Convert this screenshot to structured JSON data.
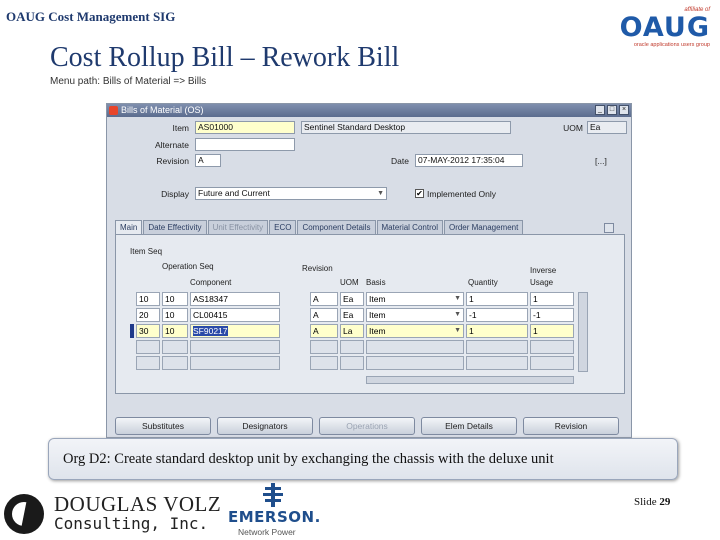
{
  "header": {
    "sig": "OAUG Cost Management SIG",
    "logo_text": "OAUG",
    "logo_affiliate": "affiliate of",
    "logo_tag": "oracle applications users group"
  },
  "slide": {
    "title": "Cost Rollup Bill – Rework Bill",
    "menu_path": "Menu path:  Bills of Material => Bills"
  },
  "form": {
    "window_title": "Bills of Material (OS)",
    "item_label": "Item",
    "item_value": "AS01000",
    "item_desc": "Sentinel Standard Desktop",
    "uom_label": "UOM",
    "uom_value": "Ea",
    "alternate_label": "Alternate",
    "revision_label": "Revision",
    "revision_value": "A",
    "date_label": "Date",
    "date_value": "07-MAY-2012 17:35:04",
    "date_btn": "[...]",
    "display_label": "Display",
    "display_value": "Future and Current",
    "implemented_label": "Implemented Only",
    "implemented_checked": "✔",
    "tabs": [
      "Main",
      "Date Effectivity",
      "Unit Effectivity",
      "ECO",
      "Component Details",
      "Material Control",
      "Order Management"
    ],
    "group_label": "Item Seq",
    "col_op_seq": "Operation Seq",
    "col_revision": "Revision",
    "col_component": "Component",
    "col_uom": "UOM",
    "col_basis": "Basis",
    "col_quantity": "Quantity",
    "col_inverse": "Inverse",
    "col_usage": "Usage",
    "rows": [
      {
        "item_seq": "10",
        "op_seq": "10",
        "component": "AS18347",
        "revision": "A",
        "uom": "Ea",
        "basis": "Item",
        "quantity": "1",
        "inverse": "1"
      },
      {
        "item_seq": "20",
        "op_seq": "10",
        "component": "CL00415",
        "revision": "A",
        "uom": "Ea",
        "basis": "Item",
        "quantity": "-1",
        "inverse": "-1"
      },
      {
        "item_seq": "30",
        "op_seq": "10",
        "component": "SF90217",
        "revision": "A",
        "uom": "La",
        "basis": "Item",
        "quantity": "1",
        "inverse": "1"
      }
    ],
    "buttons": [
      "Substitutes",
      "Designators",
      "Operations",
      "Elem Details",
      "Revision"
    ]
  },
  "caption": "Org D2:  Create standard desktop unit by exchanging the chassis with the deluxe unit",
  "footer": {
    "dv_name": "DOUGLAS VOLZ",
    "dv_sub": "Consulting, Inc.",
    "emerson_name": "EMERSON.",
    "emerson_sub": "Network Power",
    "slide_label": "Slide",
    "slide_number": "29"
  }
}
